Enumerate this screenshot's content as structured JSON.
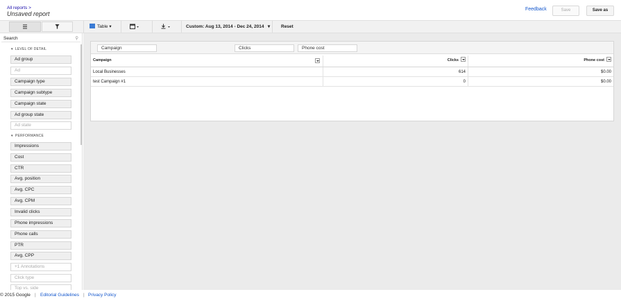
{
  "header": {
    "breadcrumb": "All reports >",
    "title": "Unsaved report",
    "feedback": "Feedback",
    "save": "Save",
    "save_as": "Save as"
  },
  "toolbar": {
    "view_label": "Table",
    "date_range": "Custom: Aug 13, 2014 - Dec 24, 2014",
    "reset": "Reset"
  },
  "sidebar": {
    "search_placeholder": "Search",
    "sections": {
      "detail": "LEVEL OF DETAIL",
      "performance": "PERFORMANCE"
    },
    "detail_fields": [
      "Ad group",
      "Ad",
      "Campaign type",
      "Campaign subtype",
      "Campaign state",
      "Ad group state",
      "Ad state"
    ],
    "performance_fields": [
      "Impressions",
      "Cost",
      "CTR",
      "Avg. position",
      "Avg. CPC",
      "Avg. CPM",
      "Invalid clicks",
      "Phone impressions",
      "Phone calls",
      "PTR",
      "Avg. CPP",
      "+1 Annotations",
      "Click type",
      "Top vs. side"
    ]
  },
  "report": {
    "row_chip": "Campaign",
    "value_chips": [
      "Clicks",
      "Phone cost"
    ],
    "columns": [
      "Campaign",
      "Clicks",
      "Phone cost"
    ],
    "rows": [
      [
        "Local Businesses",
        "614",
        "$0.00"
      ],
      [
        "test Campaign #1",
        "0",
        "$0.00"
      ]
    ]
  },
  "footer": {
    "copyright": "© 2015 Google",
    "separator": "|",
    "links": [
      "Editorial Guidelines",
      "Privacy Policy"
    ]
  }
}
